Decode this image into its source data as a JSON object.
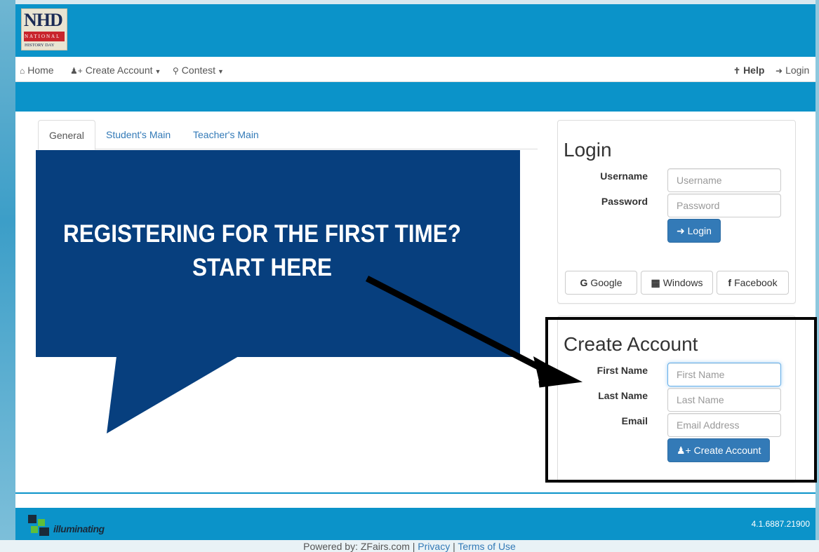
{
  "header": {
    "logo_main": "NHD",
    "logo_line1": "NATIONAL",
    "logo_line2": "HISTORY DAY"
  },
  "nav": {
    "home": "Home",
    "create_account": "Create Account",
    "contest": "Contest",
    "help": "Help",
    "login": "Login"
  },
  "tabs": [
    "General",
    "Student's Main",
    "Teacher's Main"
  ],
  "callout": {
    "line1": "REGISTERING FOR THE FIRST TIME?",
    "line2": "START HERE"
  },
  "login_panel": {
    "title": "Login",
    "username_label": "Username",
    "username_placeholder": "Username",
    "password_label": "Password",
    "password_placeholder": "Password",
    "login_button": "Login",
    "google": "Google",
    "windows": "Windows",
    "facebook": "Facebook"
  },
  "create_panel": {
    "title": "Create Account",
    "first_name_label": "First Name",
    "first_name_placeholder": "First Name",
    "last_name_label": "Last Name",
    "last_name_placeholder": "Last Name",
    "email_label": "Email",
    "email_placeholder": "Email Address",
    "create_button": "Create Account"
  },
  "footer": {
    "logo_text": "illuminating",
    "version": "4.1.6887.21900",
    "powered_by": "Powered by: ZFairs.com",
    "privacy": "Privacy",
    "terms": "Terms of Use",
    "separator": "|"
  },
  "colors": {
    "brand_blue": "#0b93c9",
    "callout_navy": "#073f7e",
    "button_primary": "#337ab7"
  }
}
